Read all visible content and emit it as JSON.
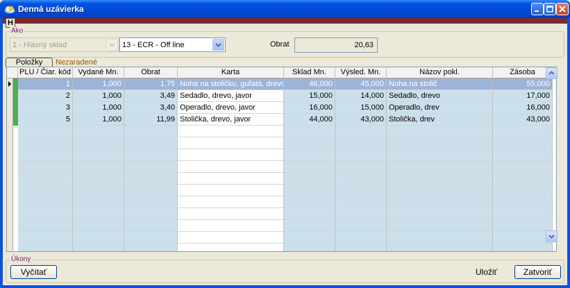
{
  "window": {
    "title": "Denná uzávierka"
  },
  "menu": {
    "h_label": "H"
  },
  "ako": {
    "group_label": "Ako",
    "warehouse_value": "1 - Hlavný sklad",
    "ecr_value": "13 - ECR - Off line",
    "obrat_label": "Obrat",
    "obrat_value": "20,63"
  },
  "tabs": {
    "polozky": "Položky",
    "nezaradene": "Nezaradené"
  },
  "grid": {
    "headers": {
      "plu": "PLU / Čiar. kód",
      "vydane": "Vydané Mn.",
      "obrat": "Obrat",
      "karta": "Karta",
      "sklad": "Sklad Mn.",
      "vysled": "Výsled. Mn.",
      "nazov": "Názov pokl.",
      "zasoba": "Zásoba"
    },
    "rows": [
      {
        "plu": "1",
        "vydane": "1,000",
        "obrat": "1,75",
        "karta": "Noha na stoličku, guľatá, drevo",
        "sklad": "46,000",
        "vysled": "45,000",
        "nazov": "Noha na stolič",
        "zasoba": "55,000"
      },
      {
        "plu": "2",
        "vydane": "1,000",
        "obrat": "3,49",
        "karta": "Sedadlo, drevo, javor",
        "sklad": "15,000",
        "vysled": "14,000",
        "nazov": "Sedadlo, drevo",
        "zasoba": "17,000"
      },
      {
        "plu": "3",
        "vydane": "1,000",
        "obrat": "3,40",
        "karta": "Operadlo, drevo, javor",
        "sklad": "16,000",
        "vysled": "15,000",
        "nazov": "Operadlo, drev",
        "zasoba": "16,000"
      },
      {
        "plu": "5",
        "vydane": "1,000",
        "obrat": "11,99",
        "karta": "Stolička, drevo, javor",
        "sklad": "44,000",
        "vysled": "43,000",
        "nazov": "Stolička, drev",
        "zasoba": "43,000"
      }
    ]
  },
  "ukony": {
    "group_label": "Úkony",
    "vycitat": "Vyčítať",
    "ulozit": "Uložiť",
    "zatvorit": "Zatvoriť"
  },
  "colors": {
    "title_bar": "#0054e3",
    "accent_strip": "#7a2a32",
    "selected_row": "#9db4d8",
    "cell_blue": "#cce0ec"
  }
}
